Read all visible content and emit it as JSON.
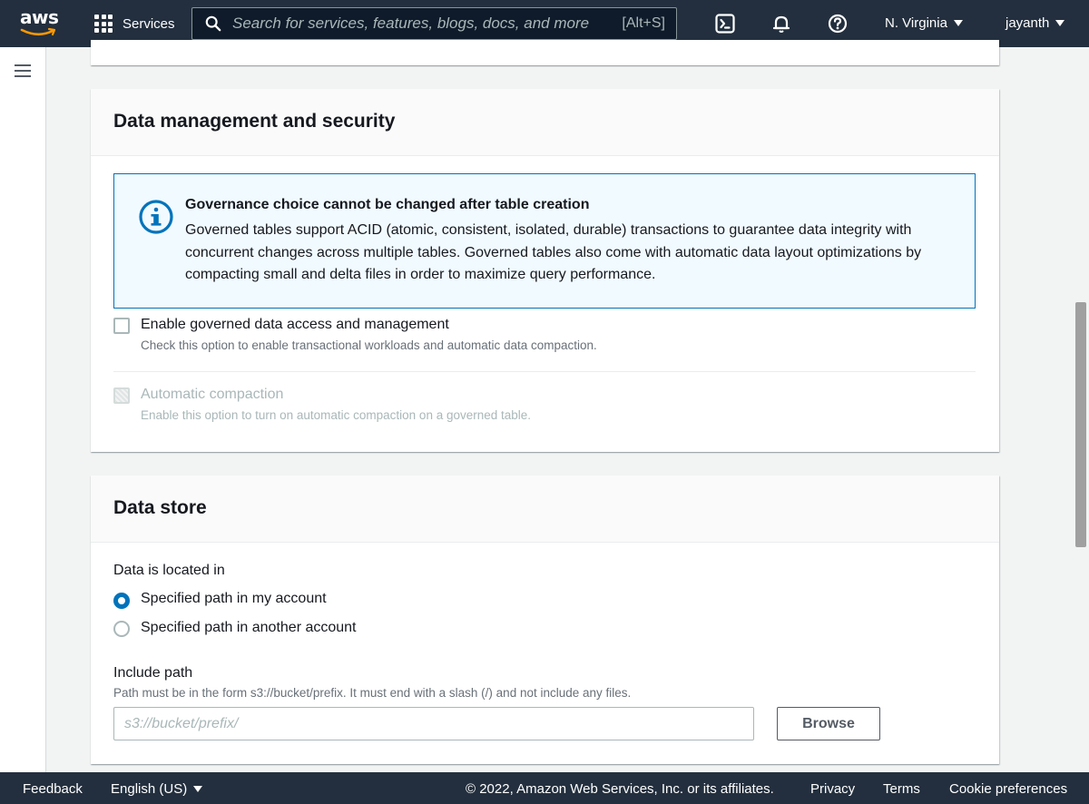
{
  "topnav": {
    "logo_text": "aws",
    "services_label": "Services",
    "search_placeholder": "Search for services, features, blogs, docs, and more",
    "search_shortcut": "[Alt+S]",
    "region": "N. Virginia",
    "user": "jayanth"
  },
  "data_management": {
    "title": "Data management and security",
    "alert_title": "Governance choice cannot be changed after table creation",
    "alert_body": "Governed tables support ACID (atomic, consistent, isolated, durable) transactions to guarantee data integrity with concurrent changes across multiple tables. Governed tables also come with automatic data layout optimizations by compacting small and delta files in order to maximize query performance.",
    "governed_label": "Enable governed data access and management",
    "governed_desc": "Check this option to enable transactional workloads and automatic data compaction.",
    "governed_checked": false,
    "compaction_label": "Automatic compaction",
    "compaction_desc": "Enable this option to turn on automatic compaction on a governed table.",
    "compaction_disabled": true
  },
  "data_store": {
    "title": "Data store",
    "location_label": "Data is located in",
    "options": [
      {
        "label": "Specified path in my account",
        "selected": true
      },
      {
        "label": "Specified path in another account",
        "selected": false
      }
    ],
    "include_path_label": "Include path",
    "include_path_hint": "Path must be in the form s3://bucket/prefix. It must end with a slash (/) and not include any files.",
    "include_path_value": "",
    "include_path_placeholder": "s3://bucket/prefix/",
    "browse_label": "Browse"
  },
  "footer": {
    "feedback": "Feedback",
    "language": "English (US)",
    "copyright": "© 2022, Amazon Web Services, Inc. or its affiliates.",
    "privacy": "Privacy",
    "terms": "Terms",
    "cookies": "Cookie preferences"
  },
  "colors": {
    "nav_bg": "#232f3e",
    "accent": "#0073bb",
    "alert_bg": "#f1faff",
    "page_bg": "#f2f3f3"
  },
  "icons": [
    "aws-logo",
    "grid-icon",
    "search-icon",
    "cloudshell-icon",
    "bell-icon",
    "help-icon",
    "menu-icon",
    "info-icon",
    "caret-down-icon"
  ]
}
